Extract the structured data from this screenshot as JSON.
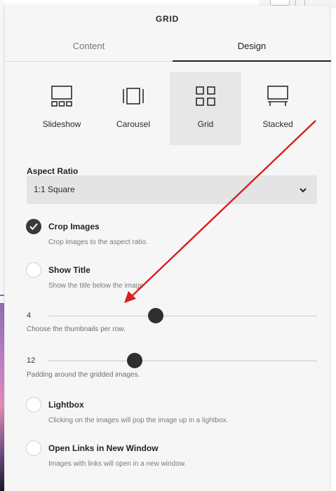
{
  "panel": {
    "title": "GRID"
  },
  "tabs": [
    {
      "label": "Content",
      "active": false
    },
    {
      "label": "Design",
      "active": true
    }
  ],
  "layouts": [
    {
      "label": "Slideshow",
      "icon": "slideshow-layout-icon",
      "selected": false
    },
    {
      "label": "Carousel",
      "icon": "carousel-layout-icon",
      "selected": false
    },
    {
      "label": "Grid",
      "icon": "grid-layout-icon",
      "selected": true
    },
    {
      "label": "Stacked",
      "icon": "stacked-layout-icon",
      "selected": false
    }
  ],
  "aspect_ratio": {
    "label": "Aspect Ratio",
    "value": "1:1 Square"
  },
  "options": {
    "crop": {
      "title": "Crop Images",
      "desc": "Crop images to the aspect ratio.",
      "checked": true
    },
    "show_title": {
      "title": "Show Title",
      "desc": "Show the title below the image",
      "checked": false
    },
    "lightbox": {
      "title": "Lightbox",
      "desc": "Clicking on the images will pop the image up in a lightbox.",
      "checked": false
    },
    "new_window": {
      "title": "Open Links in New Window",
      "desc": "Images with links will open in a new window.",
      "checked": false
    }
  },
  "sliders": {
    "per_row": {
      "value": "4",
      "desc": "Choose the thumbnails per row.",
      "level": 0.4
    },
    "padding": {
      "value": "12",
      "desc": "Padding around the gridded images.",
      "level": 0.32
    }
  },
  "colors": {
    "annotation_arrow": "#d91e1e",
    "selected_tile": "#e7e7e7",
    "thumb": "#2f2f2f"
  }
}
